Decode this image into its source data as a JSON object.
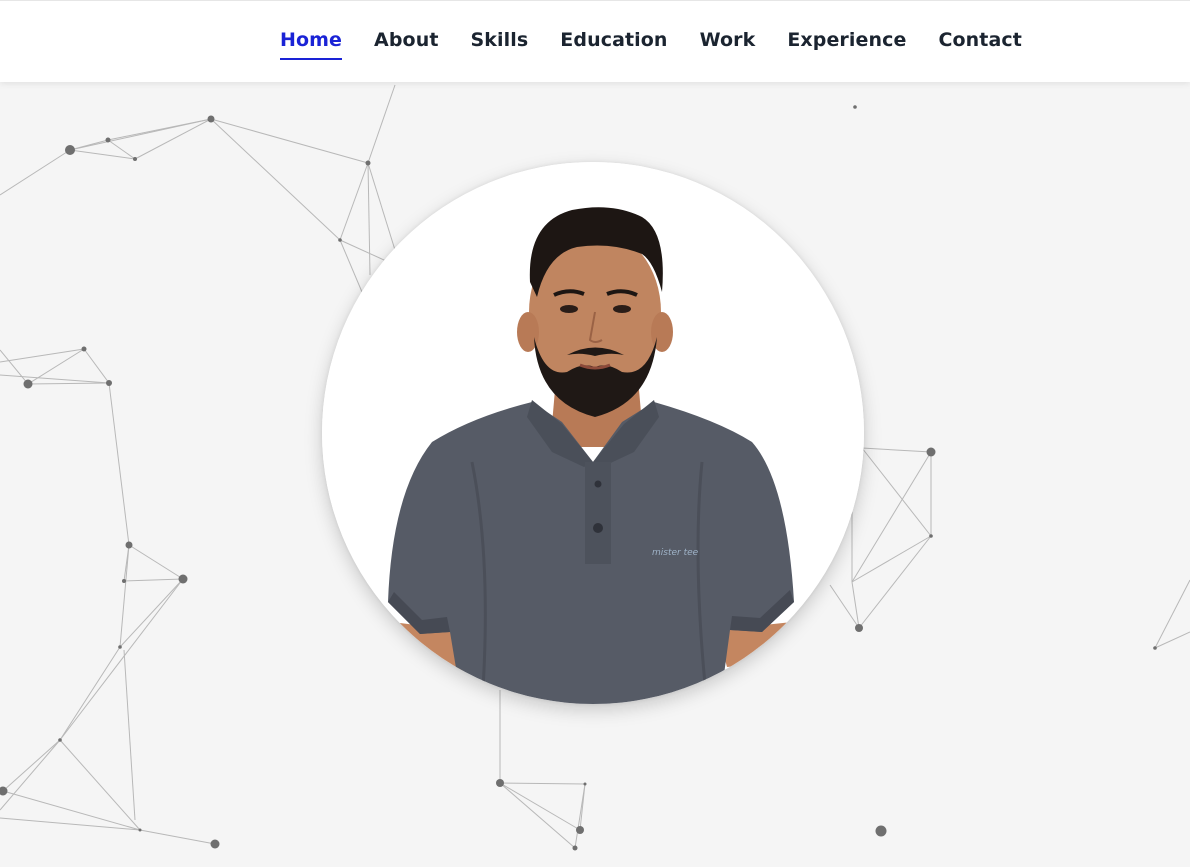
{
  "nav": {
    "items": [
      {
        "label": "Home",
        "active": true
      },
      {
        "label": "About",
        "active": false
      },
      {
        "label": "Skills",
        "active": false
      },
      {
        "label": "Education",
        "active": false
      },
      {
        "label": "Work",
        "active": false
      },
      {
        "label": "Experience",
        "active": false
      },
      {
        "label": "Contact",
        "active": false
      }
    ]
  },
  "profile": {
    "shirt_text": "mister tee"
  },
  "colors": {
    "accent": "#1a23d6",
    "nav_text": "#1b2430",
    "background": "#f5f5f5",
    "network_line": "#b5b5b5",
    "network_node": "#6e6e6e"
  }
}
